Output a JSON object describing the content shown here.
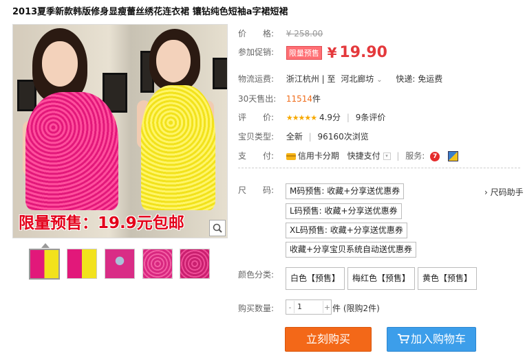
{
  "product": {
    "title": "2013夏季新款韩版修身显瘦蕾丝绣花连衣裙 镶钻纯色短袖a字裙短裙",
    "image_overlay_text": "限量预售：19.9元包邮"
  },
  "price": {
    "label": "价　　格:",
    "original": "¥ 258.00",
    "promo_label": "参加促销:",
    "promo_tag": "限量预售",
    "currency": "¥",
    "current": "19.90"
  },
  "shipping": {
    "label": "物流运费:",
    "from": "浙江杭州",
    "to_sep": "| 至",
    "to": "河北廊坊",
    "dropdown": "⌄",
    "express": "快递: 免运费"
  },
  "sales": {
    "label": "30天售出:",
    "count": "11514",
    "unit": "件"
  },
  "rating": {
    "label": "评　　价:",
    "stars": "★★★★★",
    "score": "4.9分",
    "reviews": "9条评价"
  },
  "item_type": {
    "label": "宝贝类型:",
    "condition": "全新",
    "views": "96160次浏览"
  },
  "payment": {
    "label": "支　　付:",
    "credit": "信用卡分期",
    "quick": "快捷支付",
    "service_label": "服务:"
  },
  "size": {
    "label": "尺　　码:",
    "helper": "› 尺码助手",
    "options": [
      "M码预售: 收藏+分享送优惠券",
      "L码预售: 收藏+分享送优惠券",
      "XL码预售: 收藏+分享送优惠券",
      "收藏+分享宝贝系统自动送优惠券"
    ]
  },
  "color": {
    "label": "颜色分类:",
    "options": [
      "白色【预售】",
      "梅红色【预售】",
      "黄色【预售】"
    ]
  },
  "quantity": {
    "label": "购买数量:",
    "minus": "-",
    "value": "1",
    "plus": "+",
    "unit": "件 (限购2件)"
  },
  "actions": {
    "buy_now": "立刻购买",
    "add_cart": "加入购物车"
  },
  "colors": {
    "price_red": "#e4393c",
    "buy_orange": "#f36818",
    "cart_blue": "#3c9eea"
  }
}
